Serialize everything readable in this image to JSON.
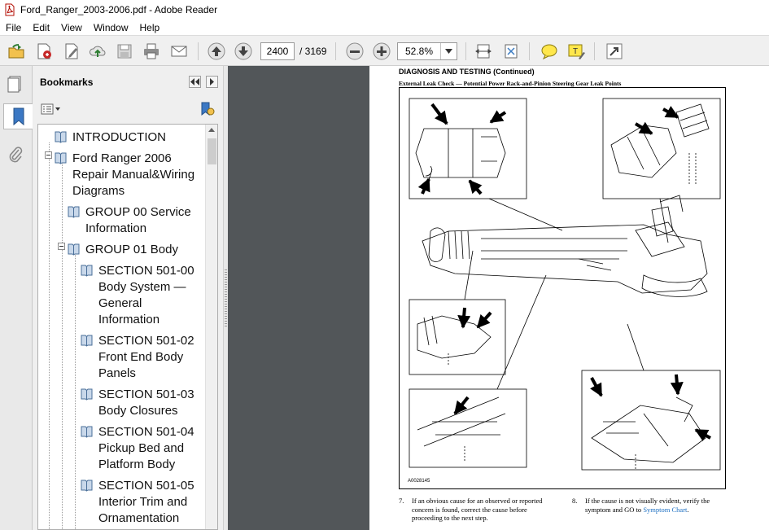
{
  "window": {
    "title": "Ford_Ranger_2003-2006.pdf - Adobe Reader"
  },
  "menu": {
    "items": [
      "File",
      "Edit",
      "View",
      "Window",
      "Help"
    ]
  },
  "toolbar": {
    "current_page": "2400",
    "total_pages": "/ 3169",
    "zoom": "52.8%"
  },
  "sidebar": {
    "title": "Bookmarks"
  },
  "bookmarks": {
    "items": [
      {
        "label": "INTRODUCTION"
      },
      {
        "label": "Ford Ranger 2006\nRepair Manual&Wiring\nDiagrams"
      },
      {
        "label": "GROUP 00  Service\nInformation"
      },
      {
        "label": "GROUP 01  Body"
      },
      {
        "label": "SECTION 501-00\nBody System —\nGeneral\nInformation"
      },
      {
        "label": "SECTION 501-02\nFront End Body\nPanels"
      },
      {
        "label": "SECTION 501-03\nBody Closures"
      },
      {
        "label": "SECTION 501-04\nPickup Bed and\nPlatform Body"
      },
      {
        "label": "SECTION 501-05\nInterior Trim and\nOrnamentation"
      }
    ]
  },
  "document": {
    "heading": "DIAGNOSIS AND TESTING (Continued)",
    "subheading": "External Leak Check — Potential Power Rack-and-Pinion Steering Gear Leak Points",
    "figure_code": "A0028145",
    "steps": [
      {
        "num": "7.",
        "text": "If an obvious cause for an observed or reported\nconcern is found, correct the cause before\nproceeding to the next step."
      },
      {
        "num": "8.",
        "text_before": "If the cause is not visually evident, verify the\nsymptom and GO to ",
        "link": "Symptom Chart",
        "text_after": "."
      }
    ]
  }
}
